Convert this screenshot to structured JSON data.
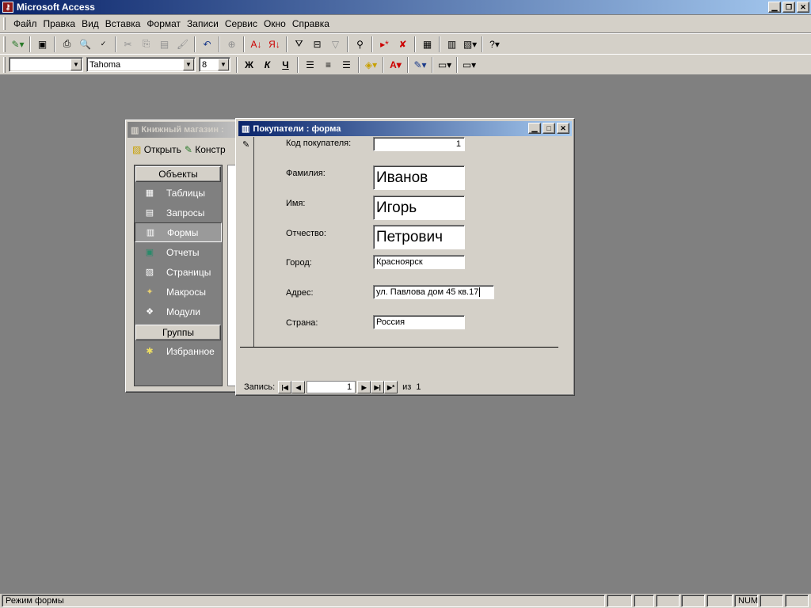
{
  "app": {
    "title": "Microsoft Access"
  },
  "menu": [
    "Файл",
    "Правка",
    "Вид",
    "Вставка",
    "Формат",
    "Записи",
    "Сервис",
    "Окно",
    "Справка"
  ],
  "format_toolbar": {
    "object_value": "",
    "font_name": "Tahoma",
    "font_size": "8",
    "bold": "Ж",
    "italic": "К",
    "underline": "Ч"
  },
  "db_window": {
    "title": "Книжный магазин :",
    "open_label": "Открыть",
    "design_label": "Констр",
    "objects_header": "Объекты",
    "groups_header": "Группы",
    "objects": [
      {
        "label": "Таблицы",
        "icon": "table-icon"
      },
      {
        "label": "Запросы",
        "icon": "query-icon"
      },
      {
        "label": "Формы",
        "icon": "form-icon"
      },
      {
        "label": "Отчеты",
        "icon": "report-icon"
      },
      {
        "label": "Страницы",
        "icon": "page-icon"
      },
      {
        "label": "Макросы",
        "icon": "macro-icon"
      },
      {
        "label": "Модули",
        "icon": "module-icon"
      }
    ],
    "selected_object": "Формы",
    "groups": [
      {
        "label": "Избранное",
        "icon": "favorites-icon"
      }
    ]
  },
  "form_window": {
    "title": "Покупатели : форма",
    "fields": [
      {
        "label": "Код покупателя:",
        "value": "1"
      },
      {
        "label": "Фамилия:",
        "value": "Иванов"
      },
      {
        "label": "Имя:",
        "value": "Игорь"
      },
      {
        "label": "Отчество:",
        "value": "Петрович"
      },
      {
        "label": "Город:",
        "value": "Красноярск"
      },
      {
        "label": "Адрес:",
        "value": "ул. Павлова дом 45 кв.17"
      },
      {
        "label": "Страна:",
        "value": "Россия"
      }
    ],
    "nav": {
      "record_label": "Запись:",
      "current": "1",
      "of_label": "из",
      "total": "1"
    }
  },
  "status": {
    "text": "Режим формы",
    "num": "NUM"
  }
}
